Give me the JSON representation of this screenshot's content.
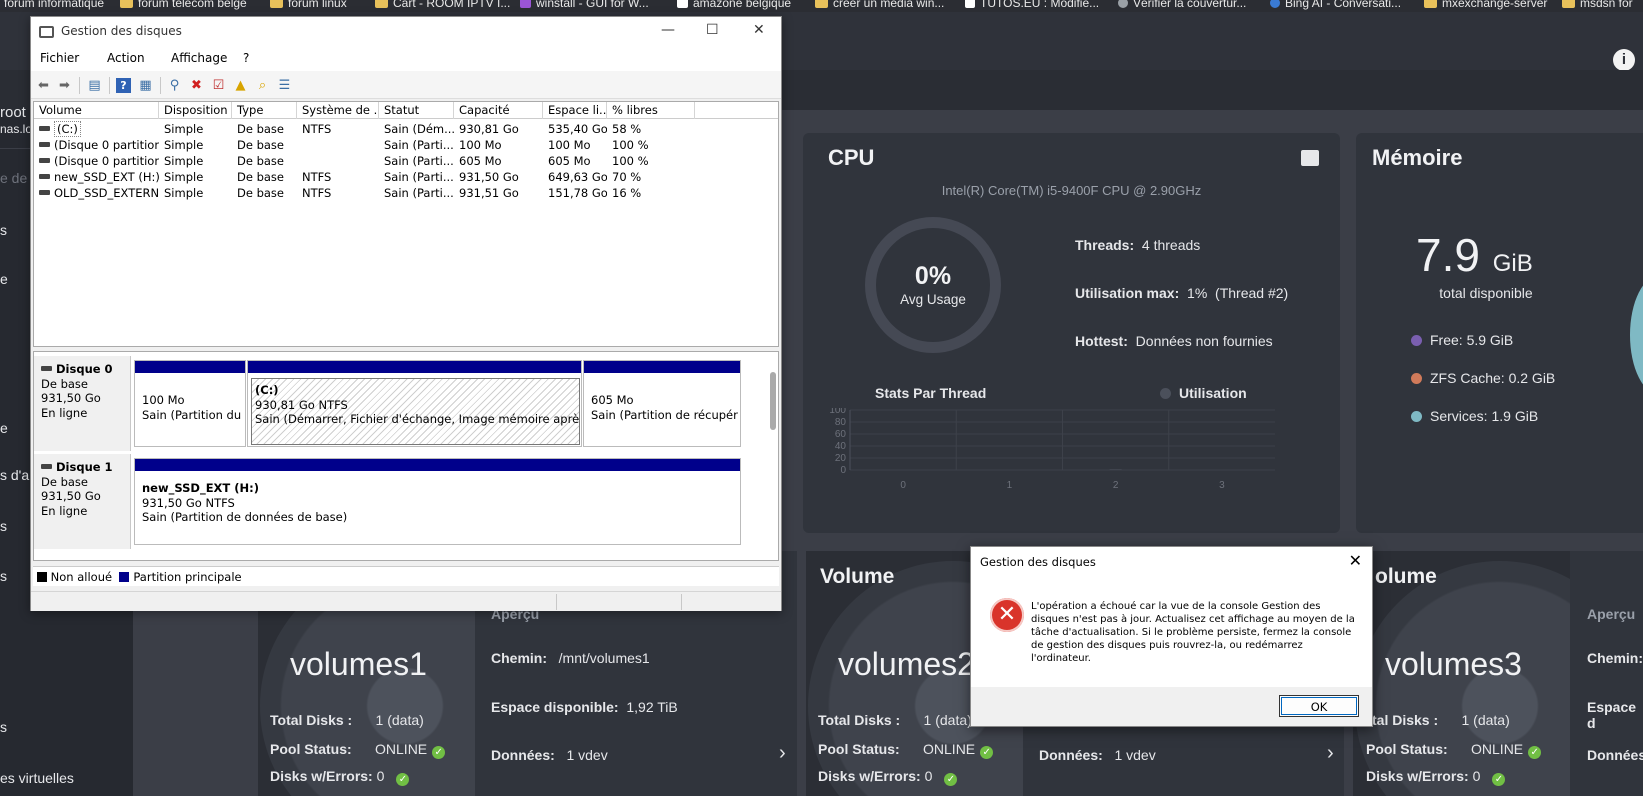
{
  "bookmarks": [
    "forum informatique",
    "forum telecom belge",
    "forum linux",
    "Cart - ROOM IPTV I...",
    "winstall - GUI for W...",
    "amazone belgique",
    "créer un média win...",
    "TUTOS.EU : Modifie...",
    "Vérifier la couvertur...",
    "Bing AI - Conversati...",
    "mxexchange-server",
    "msdsn for"
  ],
  "colors": {
    "truenas_bg": "#3b3e47",
    "card_bg": "#30343c",
    "partition_primary": "#00008b",
    "unallocated": "#000000",
    "error_red": "#d9342b",
    "status_ok": "#71bf44"
  },
  "truenas": {
    "logo": "i",
    "sidebar": [
      "root",
      "nas.lo",
      "e de b",
      "s",
      "e",
      "e",
      "s d'ar",
      "s",
      "s",
      "s",
      "es virtuelles"
    ],
    "cpu": {
      "title": "CPU",
      "model": "Intel(R) Core(TM) i5-9400F CPU @ 2.90GHz",
      "avg_value": "0%",
      "avg_label": "Avg Usage",
      "threads_label": "Threads:",
      "threads_value": "4 threads",
      "max_label": "Utilisation max:",
      "max_value": "1%",
      "max_thread": "(Thread #2)",
      "hottest_label": "Hottest:",
      "hottest_value": "Données non fournies",
      "stats_title": "Stats Par Thread",
      "legend": "Utilisation"
    },
    "thread_chart": {
      "type": "bar",
      "categories": [
        "0",
        "1",
        "2",
        "3"
      ],
      "values": [
        0,
        0,
        1,
        0
      ],
      "yticks": [
        "100",
        "80",
        "60",
        "40",
        "20",
        "0"
      ],
      "ylim": [
        0,
        100
      ]
    },
    "memory": {
      "title": "Mémoire",
      "total_value": "7.9",
      "total_unit": "GiB",
      "total_label": "total disponible",
      "legend": [
        {
          "label": "Free: 5.9 GiB",
          "color": "#7a5fb0"
        },
        {
          "label": "ZFS Cache: 0.2 GiB",
          "color": "#d07a5a"
        },
        {
          "label": "Services: 1.9 GiB",
          "color": "#7fb9c4"
        }
      ]
    },
    "volumes": [
      {
        "title": "",
        "name": "volumes1",
        "total_disks_label": "Total Disks :",
        "total_disks": "1 (data)",
        "pool_label": "Pool Status:",
        "pool": "ONLINE",
        "errors_label": "Disks w/Errors:",
        "errors": "0",
        "apercu": "Aperçu",
        "chemin_label": "Chemin:",
        "chemin": "/mnt/volumes1",
        "espace_label": "Espace disponible:",
        "espace": "1,92 TiB",
        "donnees_label": "Données:",
        "donnees": "1 vdev"
      },
      {
        "title": "Volume",
        "name": "volumes2",
        "total_disks_label": "Total Disks :",
        "total_disks": "1 (data)",
        "pool_label": "Pool Status:",
        "pool": "ONLINE",
        "errors_label": "Disks w/Errors:",
        "errors": "0",
        "donnees_label": "Données:",
        "donnees": "1 vdev"
      },
      {
        "title": "olume",
        "name": "volumes3",
        "total_disks_label": "tal Disks :",
        "total_disks": "1 (data)",
        "pool_label": "Pool Status:",
        "pool": "ONLINE",
        "errors_label": "Disks w/Errors:",
        "errors": "0",
        "apercu": "Aperçu",
        "chemin_label": "Chemin:",
        "espace_label": "Espace d",
        "donnees_label": "Données"
      }
    ]
  },
  "disk_mgmt": {
    "title": "Gestion des disques",
    "menu": [
      "Fichier",
      "Action",
      "Affichage",
      "?"
    ],
    "columns": [
      "Volume",
      "Disposition",
      "Type",
      "Système de ...",
      "Statut",
      "Capacité",
      "Espace li...",
      "% libres"
    ],
    "rows": [
      [
        "(C:)",
        "Simple",
        "De base",
        "NTFS",
        "Sain (Dém...",
        "930,81 Go",
        "535,40 Go",
        "58 %"
      ],
      [
        "(Disque 0 partition...",
        "Simple",
        "De base",
        "",
        "Sain (Parti...",
        "100 Mo",
        "100 Mo",
        "100 %"
      ],
      [
        "(Disque 0 partition...",
        "Simple",
        "De base",
        "",
        "Sain (Parti...",
        "605 Mo",
        "605 Mo",
        "100 %"
      ],
      [
        "new_SSD_EXT (H:)",
        "Simple",
        "De base",
        "NTFS",
        "Sain (Parti...",
        "931,50 Go",
        "649,63 Go",
        "70 %"
      ],
      [
        "OLD_SSD_EXTERN...",
        "Simple",
        "De base",
        "NTFS",
        "Sain (Parti...",
        "931,51 Go",
        "151,78 Go",
        "16 %"
      ]
    ],
    "disk0": {
      "name": "Disque 0",
      "type": "De base",
      "size": "931,50 Go",
      "state": "En ligne",
      "p1_line1": "100 Mo",
      "p1_line2": "Sain (Partition du sy",
      "p2_name": "(C:)",
      "p2_line1": "930,81 Go NTFS",
      "p2_line2": "Sain (Démarrer, Fichier d'échange, Image mémoire après incide",
      "p3_line1": "605 Mo",
      "p3_line2": "Sain (Partition de récupérati"
    },
    "disk1": {
      "name": "Disque 1",
      "type": "De base",
      "size": "931,50 Go",
      "state": "En ligne",
      "p1_name": "new_SSD_EXT  (H:)",
      "p1_line1": "931,50 Go NTFS",
      "p1_line2": "Sain (Partition de données de base)"
    },
    "legend": {
      "unallocated": "Non alloué",
      "primary": "Partition principale"
    }
  },
  "dialog": {
    "title": "Gestion des disques",
    "message": "L'opération a échoué car la vue de la console Gestion des disques n'est pas à jour. Actualisez cet affichage au moyen de la tâche d'actualisation. Si le problème persiste, fermez la console de gestion des disques puis rouvrez-la, ou redémarrez l'ordinateur.",
    "ok_label": "OK"
  }
}
